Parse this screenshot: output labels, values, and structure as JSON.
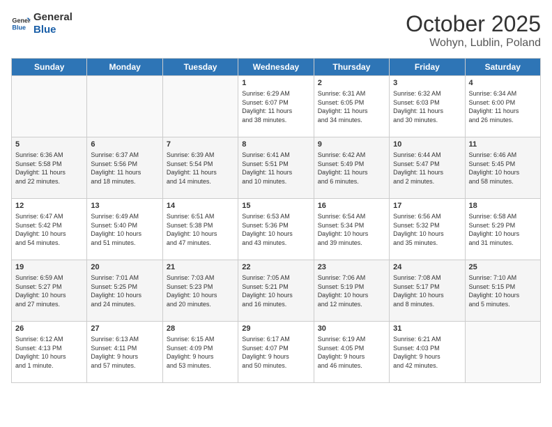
{
  "logo": {
    "line1": "General",
    "line2": "Blue"
  },
  "title": "October 2025",
  "location": "Wohyn, Lublin, Poland",
  "days_header": [
    "Sunday",
    "Monday",
    "Tuesday",
    "Wednesday",
    "Thursday",
    "Friday",
    "Saturday"
  ],
  "weeks": [
    [
      {
        "day": "",
        "content": ""
      },
      {
        "day": "",
        "content": ""
      },
      {
        "day": "",
        "content": ""
      },
      {
        "day": "1",
        "content": "Sunrise: 6:29 AM\nSunset: 6:07 PM\nDaylight: 11 hours\nand 38 minutes."
      },
      {
        "day": "2",
        "content": "Sunrise: 6:31 AM\nSunset: 6:05 PM\nDaylight: 11 hours\nand 34 minutes."
      },
      {
        "day": "3",
        "content": "Sunrise: 6:32 AM\nSunset: 6:03 PM\nDaylight: 11 hours\nand 30 minutes."
      },
      {
        "day": "4",
        "content": "Sunrise: 6:34 AM\nSunset: 6:00 PM\nDaylight: 11 hours\nand 26 minutes."
      }
    ],
    [
      {
        "day": "5",
        "content": "Sunrise: 6:36 AM\nSunset: 5:58 PM\nDaylight: 11 hours\nand 22 minutes."
      },
      {
        "day": "6",
        "content": "Sunrise: 6:37 AM\nSunset: 5:56 PM\nDaylight: 11 hours\nand 18 minutes."
      },
      {
        "day": "7",
        "content": "Sunrise: 6:39 AM\nSunset: 5:54 PM\nDaylight: 11 hours\nand 14 minutes."
      },
      {
        "day": "8",
        "content": "Sunrise: 6:41 AM\nSunset: 5:51 PM\nDaylight: 11 hours\nand 10 minutes."
      },
      {
        "day": "9",
        "content": "Sunrise: 6:42 AM\nSunset: 5:49 PM\nDaylight: 11 hours\nand 6 minutes."
      },
      {
        "day": "10",
        "content": "Sunrise: 6:44 AM\nSunset: 5:47 PM\nDaylight: 11 hours\nand 2 minutes."
      },
      {
        "day": "11",
        "content": "Sunrise: 6:46 AM\nSunset: 5:45 PM\nDaylight: 10 hours\nand 58 minutes."
      }
    ],
    [
      {
        "day": "12",
        "content": "Sunrise: 6:47 AM\nSunset: 5:42 PM\nDaylight: 10 hours\nand 54 minutes."
      },
      {
        "day": "13",
        "content": "Sunrise: 6:49 AM\nSunset: 5:40 PM\nDaylight: 10 hours\nand 51 minutes."
      },
      {
        "day": "14",
        "content": "Sunrise: 6:51 AM\nSunset: 5:38 PM\nDaylight: 10 hours\nand 47 minutes."
      },
      {
        "day": "15",
        "content": "Sunrise: 6:53 AM\nSunset: 5:36 PM\nDaylight: 10 hours\nand 43 minutes."
      },
      {
        "day": "16",
        "content": "Sunrise: 6:54 AM\nSunset: 5:34 PM\nDaylight: 10 hours\nand 39 minutes."
      },
      {
        "day": "17",
        "content": "Sunrise: 6:56 AM\nSunset: 5:32 PM\nDaylight: 10 hours\nand 35 minutes."
      },
      {
        "day": "18",
        "content": "Sunrise: 6:58 AM\nSunset: 5:29 PM\nDaylight: 10 hours\nand 31 minutes."
      }
    ],
    [
      {
        "day": "19",
        "content": "Sunrise: 6:59 AM\nSunset: 5:27 PM\nDaylight: 10 hours\nand 27 minutes."
      },
      {
        "day": "20",
        "content": "Sunrise: 7:01 AM\nSunset: 5:25 PM\nDaylight: 10 hours\nand 24 minutes."
      },
      {
        "day": "21",
        "content": "Sunrise: 7:03 AM\nSunset: 5:23 PM\nDaylight: 10 hours\nand 20 minutes."
      },
      {
        "day": "22",
        "content": "Sunrise: 7:05 AM\nSunset: 5:21 PM\nDaylight: 10 hours\nand 16 minutes."
      },
      {
        "day": "23",
        "content": "Sunrise: 7:06 AM\nSunset: 5:19 PM\nDaylight: 10 hours\nand 12 minutes."
      },
      {
        "day": "24",
        "content": "Sunrise: 7:08 AM\nSunset: 5:17 PM\nDaylight: 10 hours\nand 8 minutes."
      },
      {
        "day": "25",
        "content": "Sunrise: 7:10 AM\nSunset: 5:15 PM\nDaylight: 10 hours\nand 5 minutes."
      }
    ],
    [
      {
        "day": "26",
        "content": "Sunrise: 6:12 AM\nSunset: 4:13 PM\nDaylight: 10 hours\nand 1 minute."
      },
      {
        "day": "27",
        "content": "Sunrise: 6:13 AM\nSunset: 4:11 PM\nDaylight: 9 hours\nand 57 minutes."
      },
      {
        "day": "28",
        "content": "Sunrise: 6:15 AM\nSunset: 4:09 PM\nDaylight: 9 hours\nand 53 minutes."
      },
      {
        "day": "29",
        "content": "Sunrise: 6:17 AM\nSunset: 4:07 PM\nDaylight: 9 hours\nand 50 minutes."
      },
      {
        "day": "30",
        "content": "Sunrise: 6:19 AM\nSunset: 4:05 PM\nDaylight: 9 hours\nand 46 minutes."
      },
      {
        "day": "31",
        "content": "Sunrise: 6:21 AM\nSunset: 4:03 PM\nDaylight: 9 hours\nand 42 minutes."
      },
      {
        "day": "",
        "content": ""
      }
    ]
  ]
}
